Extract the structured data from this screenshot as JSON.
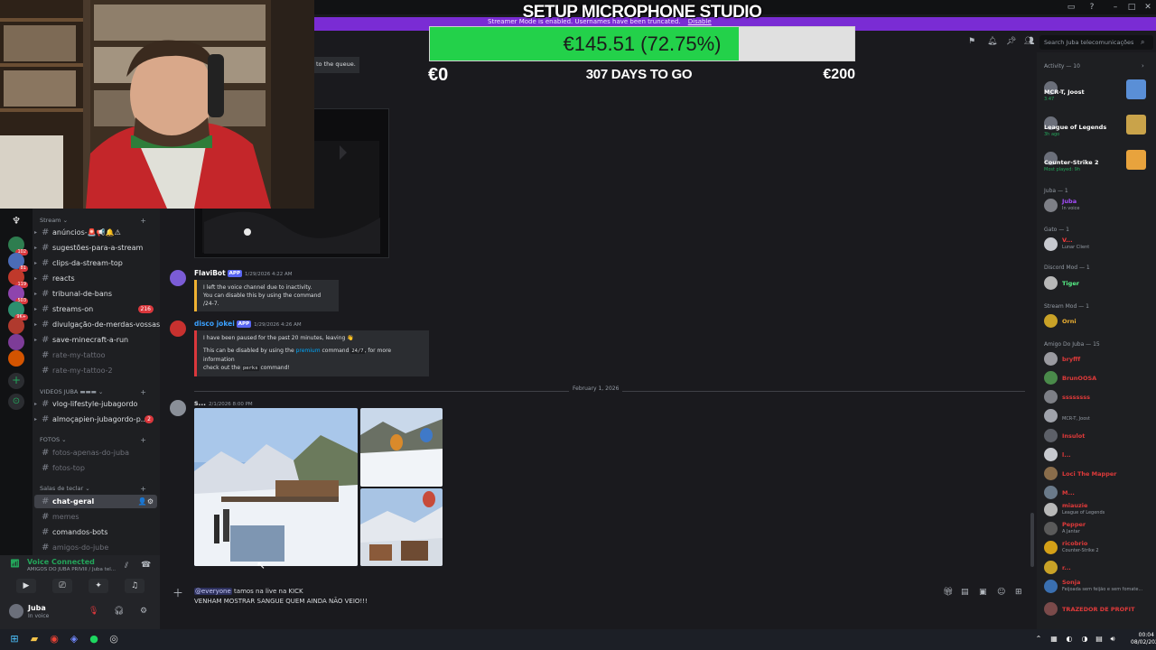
{
  "overlay": {
    "title": "SETUP MICROPHONE STUDIO",
    "goal_text": "€145.51 (72.75%)",
    "goal_progress": 0.7275,
    "goal_min": "€0",
    "goal_days": "307 DAYS TO GO",
    "goal_max": "€200"
  },
  "streamer_mode": {
    "text": "Streamer Mode is enabled. Usernames have been truncated.",
    "disable_label": "Disable"
  },
  "top": {
    "search_placeholder": "Search Juba telecomunicações"
  },
  "sidebar": {
    "categories": [
      {
        "label": "Stream"
      },
      {
        "label": "VIDEOS JUBA"
      },
      {
        "label": "FOTOS"
      },
      {
        "label": "Salas de teclar"
      }
    ],
    "channels": [
      {
        "label": "anúncios-🚨📢🔔⚠"
      },
      {
        "label": "sugestões-para-a-stream"
      },
      {
        "label": "clips-da-stream-top"
      },
      {
        "label": "reacts"
      },
      {
        "label": "tribunal-de-bans"
      },
      {
        "label": "streams-on",
        "badge": "216"
      },
      {
        "label": "divulgação-de-merdas-vossas"
      },
      {
        "label": "save-minecraft-a-run"
      },
      {
        "label": "rate-my-tattoo"
      },
      {
        "label": "rate-my-tattoo-2"
      },
      {
        "label": "vlog-lifestyle-jubagordo"
      },
      {
        "label": "almoçapien-jubagordo-p...",
        "badge": "2"
      },
      {
        "label": "fotos-apenas-do-juba"
      },
      {
        "label": "fotos-top"
      },
      {
        "label": "chat-geral"
      },
      {
        "label": "memes"
      },
      {
        "label": "comandos-bots"
      },
      {
        "label": "amigos-do-jube"
      }
    ],
    "server_badges": [
      "102",
      "81",
      "119",
      "503",
      "9K+"
    ]
  },
  "voice": {
    "status": "Voice Connected",
    "channel": "AMIGOS DO JUBA PRIVIII / Juba tel..."
  },
  "user": {
    "name": "Juba",
    "status": "In voice"
  },
  "chat": {
    "embed_fragment": "to the queue.",
    "messages": [
      {
        "author": "FlaviBot",
        "tag": "APP",
        "time": "1/29/2026 4:22 AM",
        "lines": [
          "I left the voice channel due to inactivity.",
          "You can disable this by using the command /24-7."
        ]
      },
      {
        "author": "disco jokei",
        "tag": "APP",
        "time": "1/29/2026 4:26 AM",
        "line1": "I have been paused for the past 20 minutes, leaving 👋",
        "line2_a": "This can be disabled by using the ",
        "line2_link": "premium",
        "line2_b": " command ",
        "line2_code": "24/7",
        "line2_c": ", for more information",
        "line3_a": "check out the ",
        "line3_code": "perks",
        "line3_b": " command!"
      },
      {
        "author": "s...",
        "time": "2/1/2026 8:00 PM"
      }
    ],
    "date_divider": "February 1, 2026",
    "composer": {
      "mention": "@everyone",
      "line1": " tamos na live na KICK",
      "line2": "VENHAM MOSTRAR SANGUE QUEM AINDA NÃO VEIO!!!"
    }
  },
  "members": {
    "activity_header": "Activity — 10",
    "activities": [
      {
        "name": "MCR-T, Joost",
        "sub": "3:47"
      },
      {
        "name": "League of Legends",
        "sub": "3h ago"
      },
      {
        "name": "Counter-Strike 2",
        "sub": "Most played: 9h"
      }
    ],
    "groups": [
      {
        "header": "Juba — 1",
        "members": [
          {
            "name": "Juba",
            "sub": "In voice",
            "color": "#a64dff"
          }
        ]
      },
      {
        "header": "Gato — 1",
        "members": [
          {
            "name": "V...",
            "sub": "Lunar Client",
            "color": "#ff3b3b"
          }
        ]
      },
      {
        "header": "Discord Mod — 1",
        "members": [
          {
            "name": "Tiger",
            "sub": "",
            "color": "#57f287"
          }
        ]
      },
      {
        "header": "Stream Mod — 1",
        "members": [
          {
            "name": "Orni",
            "sub": "",
            "color": "#f0b232"
          }
        ]
      },
      {
        "header": "Amigo Do Juba — 15",
        "members": [
          {
            "name": "bryfff",
            "sub": "",
            "color": "#e03a3a"
          },
          {
            "name": "BrunOOSA",
            "sub": "",
            "color": "#e03a3a"
          },
          {
            "name": "ssssssss",
            "sub": "",
            "color": "#e03a3a"
          },
          {
            "name": "",
            "sub": "MCR-T, Joost",
            "color": "#e03a3a"
          },
          {
            "name": "Insulot",
            "sub": "",
            "color": "#e03a3a"
          },
          {
            "name": "l...",
            "sub": "",
            "color": "#e03a3a"
          },
          {
            "name": "Loci The Mapper",
            "sub": "",
            "color": "#e03a3a"
          },
          {
            "name": "M...",
            "sub": "",
            "color": "#e03a3a"
          },
          {
            "name": "miauzie",
            "sub": "League of Legends",
            "color": "#e03a3a"
          },
          {
            "name": "Pepper",
            "sub": "A Jantar",
            "color": "#e03a3a"
          },
          {
            "name": "ricobrio",
            "sub": "Counter-Strike 2",
            "color": "#e03a3a"
          },
          {
            "name": "r...",
            "sub": "",
            "color": "#e03a3a"
          },
          {
            "name": "Sonja",
            "sub": "Feijoada sem feijão e sem fomate...",
            "color": "#e03a3a"
          },
          {
            "name": "TRAZEDOR DE PROFIT",
            "sub": "",
            "color": "#e03a3a"
          }
        ]
      }
    ]
  },
  "taskbar": {
    "time": "00:04",
    "date": "08/02/2026"
  }
}
